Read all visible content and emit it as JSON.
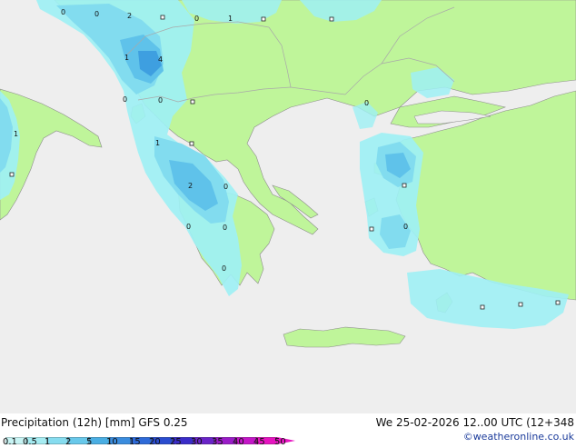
{
  "map": {
    "colors": {
      "sea": "#eeeeee",
      "land": "#bff59a",
      "precip_0": "#9ef0f4",
      "precip_1": "#82dcef",
      "precip_2": "#5fc2ea",
      "precip_3": "#3e9fe0",
      "border": "#a9a9a9",
      "coast": "#8c8c8c"
    },
    "values": [
      {
        "text": "0"
      },
      {
        "text": "0"
      },
      {
        "text": "2"
      },
      {
        "text": "0"
      },
      {
        "text": "1"
      },
      {
        "text": "1"
      },
      {
        "text": "4"
      },
      {
        "text": "0"
      },
      {
        "text": "0"
      },
      {
        "text": "0"
      },
      {
        "text": "1"
      },
      {
        "text": "1"
      },
      {
        "text": "2"
      },
      {
        "text": "0"
      },
      {
        "text": "0"
      },
      {
        "text": "0"
      },
      {
        "text": "0"
      },
      {
        "text": "0"
      }
    ]
  },
  "footer": {
    "title": "Precipitation (12h) [mm] GFS 0.25",
    "datetime": "We 25-02-2026 12..00 UTC (12+348",
    "credit": "©weatheronline.co.uk"
  },
  "legend": {
    "ticks": [
      "0.1",
      "0.5",
      "1",
      "2",
      "5",
      "10",
      "15",
      "20",
      "25",
      "30",
      "35",
      "40",
      "45",
      "50"
    ],
    "colors": [
      "#c8f4f4",
      "#a6ecf2",
      "#86dcef",
      "#68c8ea",
      "#4aaee3",
      "#3a8cde",
      "#2e6ad8",
      "#2a4ccf",
      "#3a2cc8",
      "#6a24c8",
      "#9a1cc8",
      "#c416c8",
      "#e614c0"
    ]
  }
}
